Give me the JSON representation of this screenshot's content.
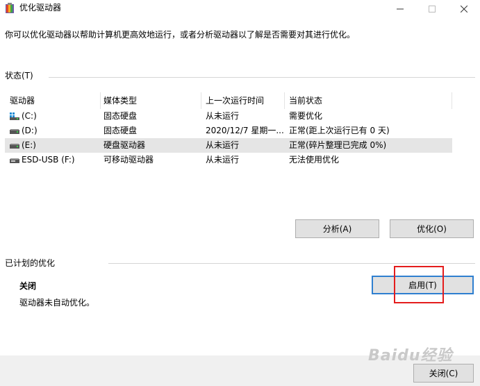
{
  "window": {
    "title": "优化驱动器",
    "controls": [
      "minimize-icon",
      "maximize-icon",
      "close-icon"
    ]
  },
  "intro_text": "你可以优化驱动器以帮助计算机更高效地运行，或者分析驱动器以了解是否需要对其进行优化。",
  "status_section": {
    "label": "状态(T)",
    "columns": [
      "驱动器",
      "媒体类型",
      "上一次运行时间",
      "当前状态"
    ],
    "rows": [
      {
        "drive": "(C:)",
        "media": "固态硬盘",
        "last_run": "从未运行",
        "status": "需要优化",
        "icon": "windows-drive-icon",
        "selected": false
      },
      {
        "drive": "(D:)",
        "media": "固态硬盘",
        "last_run": "2020/12/7 星期一...",
        "status": "正常(距上次运行已有 0 天)",
        "icon": "drive-icon",
        "selected": false
      },
      {
        "drive": "(E:)",
        "media": "硬盘驱动器",
        "last_run": "从未运行",
        "status": "正常(碎片整理已完成 0%)",
        "icon": "drive-icon",
        "selected": true
      },
      {
        "drive": "ESD-USB (F:)",
        "media": "可移动驱动器",
        "last_run": "从未运行",
        "status": "无法使用优化",
        "icon": "usb-drive-icon",
        "selected": false
      }
    ],
    "analyze_button": "分析(A)",
    "optimize_button": "优化(O)"
  },
  "schedule_section": {
    "label": "已计划的优化",
    "state": "关闭",
    "description": "驱动器未自动优化。",
    "enable_button": "启用(T)"
  },
  "footer": {
    "close_button": "关闭(C)"
  },
  "watermark": "Baidu经验",
  "colors": {
    "selection": "#e5e5e5",
    "focus_border": "#2e7fd0",
    "highlight": "#e41c1c",
    "footer_bg": "#f0f0f0"
  }
}
